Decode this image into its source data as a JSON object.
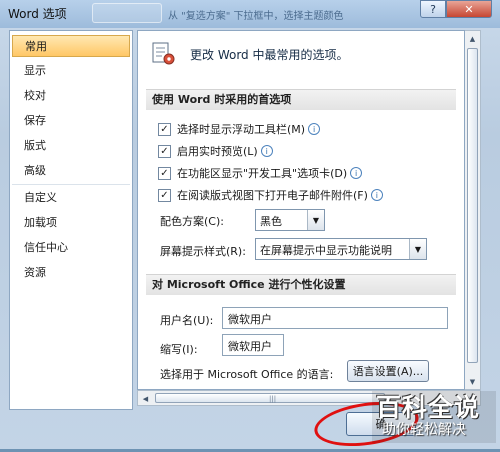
{
  "window": {
    "title": "Word 选项",
    "background_text": "从 \"复选方案\" 下拉框中，选择主题颜色",
    "help_glyph": "?",
    "close_glyph": "✕"
  },
  "nav": {
    "items": [
      {
        "label": "常用",
        "active": true
      },
      {
        "label": "显示",
        "active": false
      },
      {
        "label": "校对",
        "active": false
      },
      {
        "label": "保存",
        "active": false
      },
      {
        "label": "版式",
        "active": false
      },
      {
        "label": "高级",
        "active": false
      },
      {
        "label": "自定义",
        "active": false
      },
      {
        "label": "加载项",
        "active": false
      },
      {
        "label": "信任中心",
        "active": false
      },
      {
        "label": "资源",
        "active": false
      }
    ]
  },
  "header": {
    "title": "更改 Word 中最常用的选项。",
    "icon": "options-settings-icon"
  },
  "section1": {
    "title": "使用 Word 时采用的首选项",
    "options": [
      {
        "label": "选择时显示浮动工具栏(M)",
        "checked": true,
        "info": true
      },
      {
        "label": "启用实时预览(L)",
        "checked": true,
        "info": true
      },
      {
        "label": "在功能区显示\"开发工具\"选项卡(D)",
        "checked": true,
        "info": true
      },
      {
        "label": "在阅读版式视图下打开电子邮件附件(F)",
        "checked": true,
        "info": true
      }
    ],
    "color_scheme_label": "配色方案(C):",
    "color_scheme_value": "黑色",
    "tooltip_style_label": "屏幕提示样式(R):",
    "tooltip_style_value": "在屏幕提示中显示功能说明"
  },
  "section2": {
    "title": "对 Microsoft Office 进行个性化设置",
    "username_label": "用户名(U):",
    "username_value": "微软用户",
    "initials_label": "缩写(I):",
    "initials_value": "微软用户",
    "language_label": "选择用于 Microsoft Office 的语言:",
    "language_button": "语言设置(A)..."
  },
  "footer": {
    "ok_button": "确",
    "watermark_title": "百科全说",
    "watermark_subtitle": "助你轻松解决"
  },
  "colors": {
    "active_nav": "#ffc766",
    "annotation_circle": "#e01010",
    "close_button": "#c74632"
  }
}
